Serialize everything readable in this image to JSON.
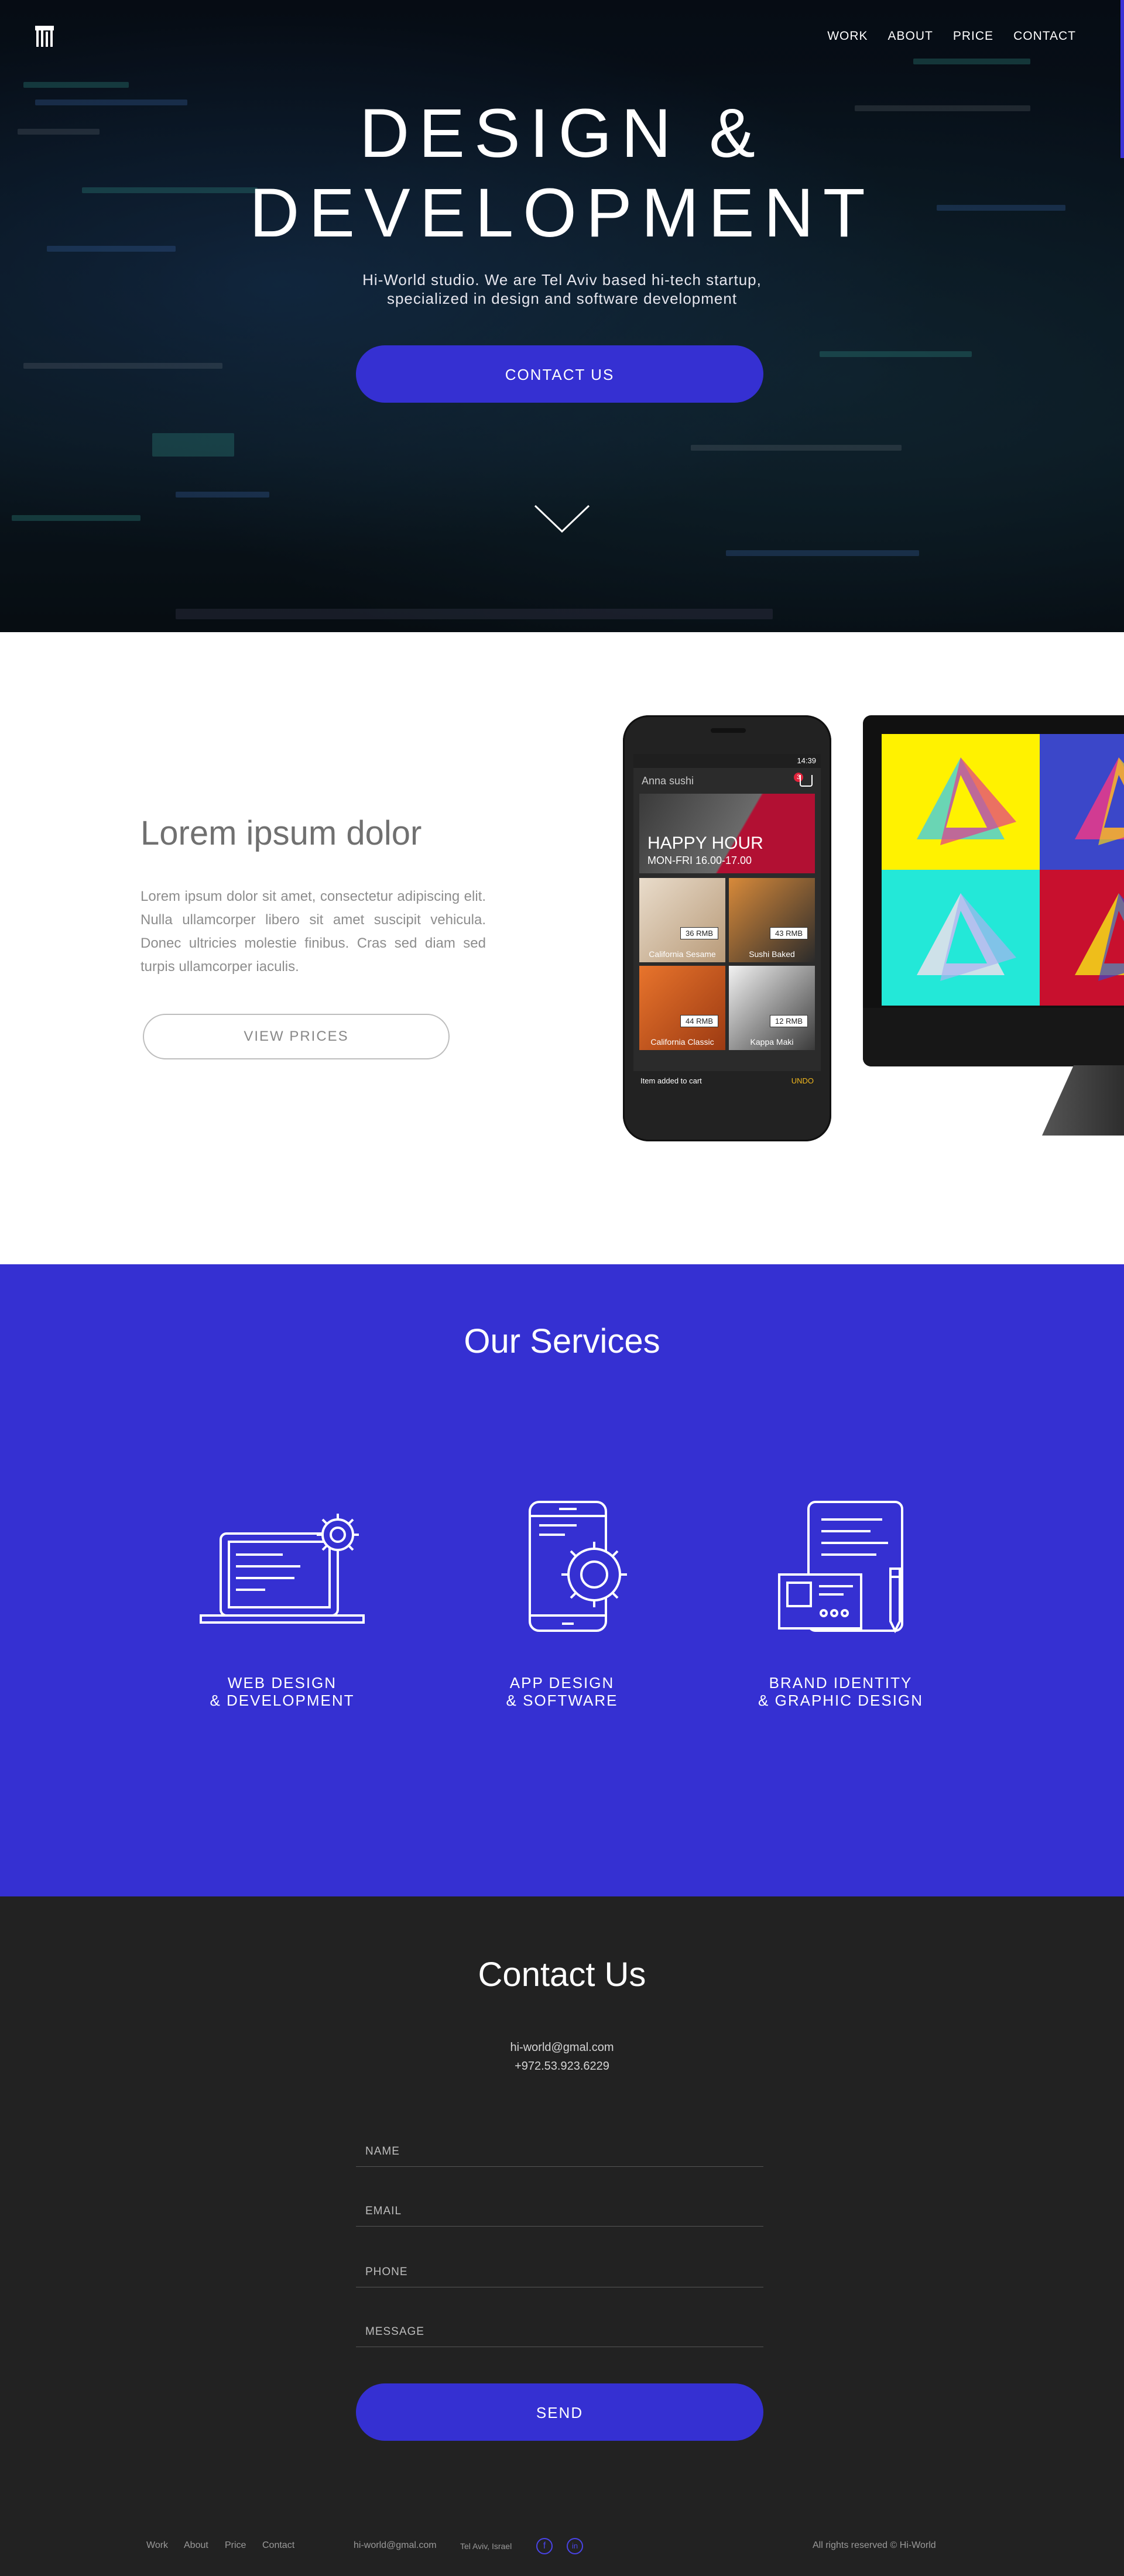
{
  "nav": {
    "items": [
      "WORK",
      "ABOUT",
      "PRICE",
      "CONTACT"
    ]
  },
  "hero": {
    "title_line1": "DESIGN &",
    "title_line2": "DEVELOPMENT",
    "subtitle_line1": "Hi-World studio. We are Tel Aviv based hi-tech startup,",
    "subtitle_line2": "specialized in design and software development",
    "cta": "CONTACT US"
  },
  "showcase": {
    "title": "Lorem ipsum dolor",
    "body": "Lorem ipsum dolor sit amet, consectetur adipiscing elit. Nulla ullamcorper libero sit amet suscipit vehicula. Donec ultricies molestie finibus. Cras sed diam sed turpis ullamcorper iaculis.",
    "button": "VIEW PRICES",
    "phone": {
      "time": "14:39",
      "app_title": "Anna sushi",
      "cart_count": "3",
      "banner_title": "HAPPY HOUR",
      "banner_subtitle": "MON-FRI 16.00-17.00",
      "items": [
        {
          "name": "California Sesame",
          "price": "36 RMB"
        },
        {
          "name": "Sushi Baked",
          "price": "43 RMB"
        },
        {
          "name": "California Classic",
          "price": "44 RMB"
        },
        {
          "name": "Kappa Maki",
          "price": "12 RMB"
        }
      ],
      "snackbar": "Item added to cart",
      "snackbar_action": "UNDO"
    }
  },
  "services": {
    "title": "Our Services",
    "items": [
      {
        "label": "WEB  DESIGN\n&  DEVELOPMENT",
        "icon": "laptop-gear-icon"
      },
      {
        "label": "APP  DESIGN\n&  SOFTWARE",
        "icon": "phone-gear-icon"
      },
      {
        "label": "BRAND IDENTITY\n&  GRAPHIC DESIGN",
        "icon": "document-pencil-icon"
      }
    ]
  },
  "contact": {
    "title": "Contact Us",
    "email": "hi-world@gmal.com",
    "phone": "+972.53.923.6229",
    "fields": {
      "name": "NAME",
      "email": "EMAIL",
      "phone": "PHONE",
      "message": "MESSAGE"
    },
    "send": "SEND"
  },
  "footer": {
    "links": [
      "Work",
      "About",
      "Price",
      "Contact"
    ],
    "email": "hi-world@gmal.com",
    "location": "Tel Aviv, Israel",
    "copyright": "All rights reserved © Hi-World"
  },
  "colors": {
    "accent": "#3530d2",
    "dark": "#222222",
    "white": "#ffffff"
  }
}
